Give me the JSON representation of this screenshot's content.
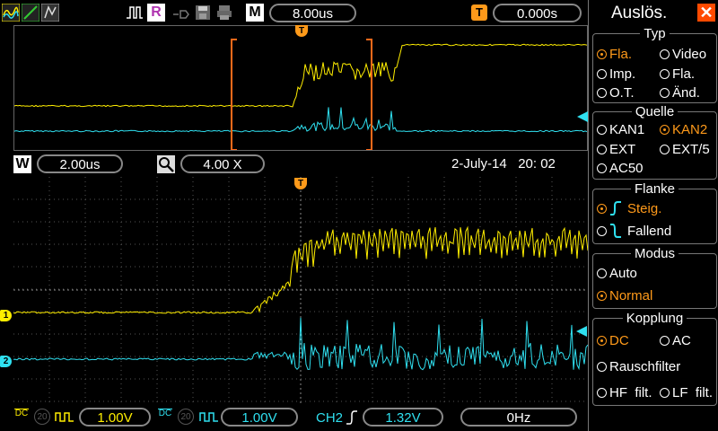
{
  "toolbar": {
    "timebase": "8.00us",
    "trigger_offset": "0.000s",
    "mode_letter": "M",
    "run_letter": "R"
  },
  "zoom": {
    "window_letter": "W",
    "window_time": "2.00us",
    "zoom_factor": "4.00  X",
    "datetime": "2-July-14   20: 02"
  },
  "channels": {
    "ch1_marker": "1",
    "ch2_marker": "2",
    "trigger_marker": "T"
  },
  "bottom": {
    "ch1_coupling": "DC",
    "ch1_bw": "20",
    "ch1_scale": "1.00V",
    "ch2_coupling": "DC",
    "ch2_bw": "20",
    "ch2_scale": "1.00V",
    "trig_source": "CH2",
    "trig_level": "1.32V",
    "frequency": "0Hz"
  },
  "panel": {
    "title": "Auslös.",
    "typ": {
      "head": "Typ",
      "options": [
        "Fla.",
        "Video",
        "Imp.",
        "Fla.",
        "O.T.",
        "Änd."
      ],
      "selected": 0
    },
    "quelle": {
      "head": "Quelle",
      "options": [
        "KAN1",
        "KAN2",
        "EXT",
        "EXT/5",
        "AC50"
      ],
      "selected": 1
    },
    "flanke": {
      "head": "Flanke",
      "options": [
        "Steig.",
        "Fallend"
      ],
      "selected": 0
    },
    "modus": {
      "head": "Modus",
      "options": [
        "Auto",
        "Normal"
      ],
      "selected": 1
    },
    "kopplung": {
      "head": "Kopplung",
      "options": [
        "DC",
        "AC",
        "Rauschfilter",
        "HF  filt.",
        "LF  filt."
      ],
      "selected": 0
    }
  },
  "colors": {
    "ch1": "#ffee00",
    "ch2": "#2fe0f0",
    "accent": "#ff9a1a",
    "close": "#ff4a00"
  }
}
